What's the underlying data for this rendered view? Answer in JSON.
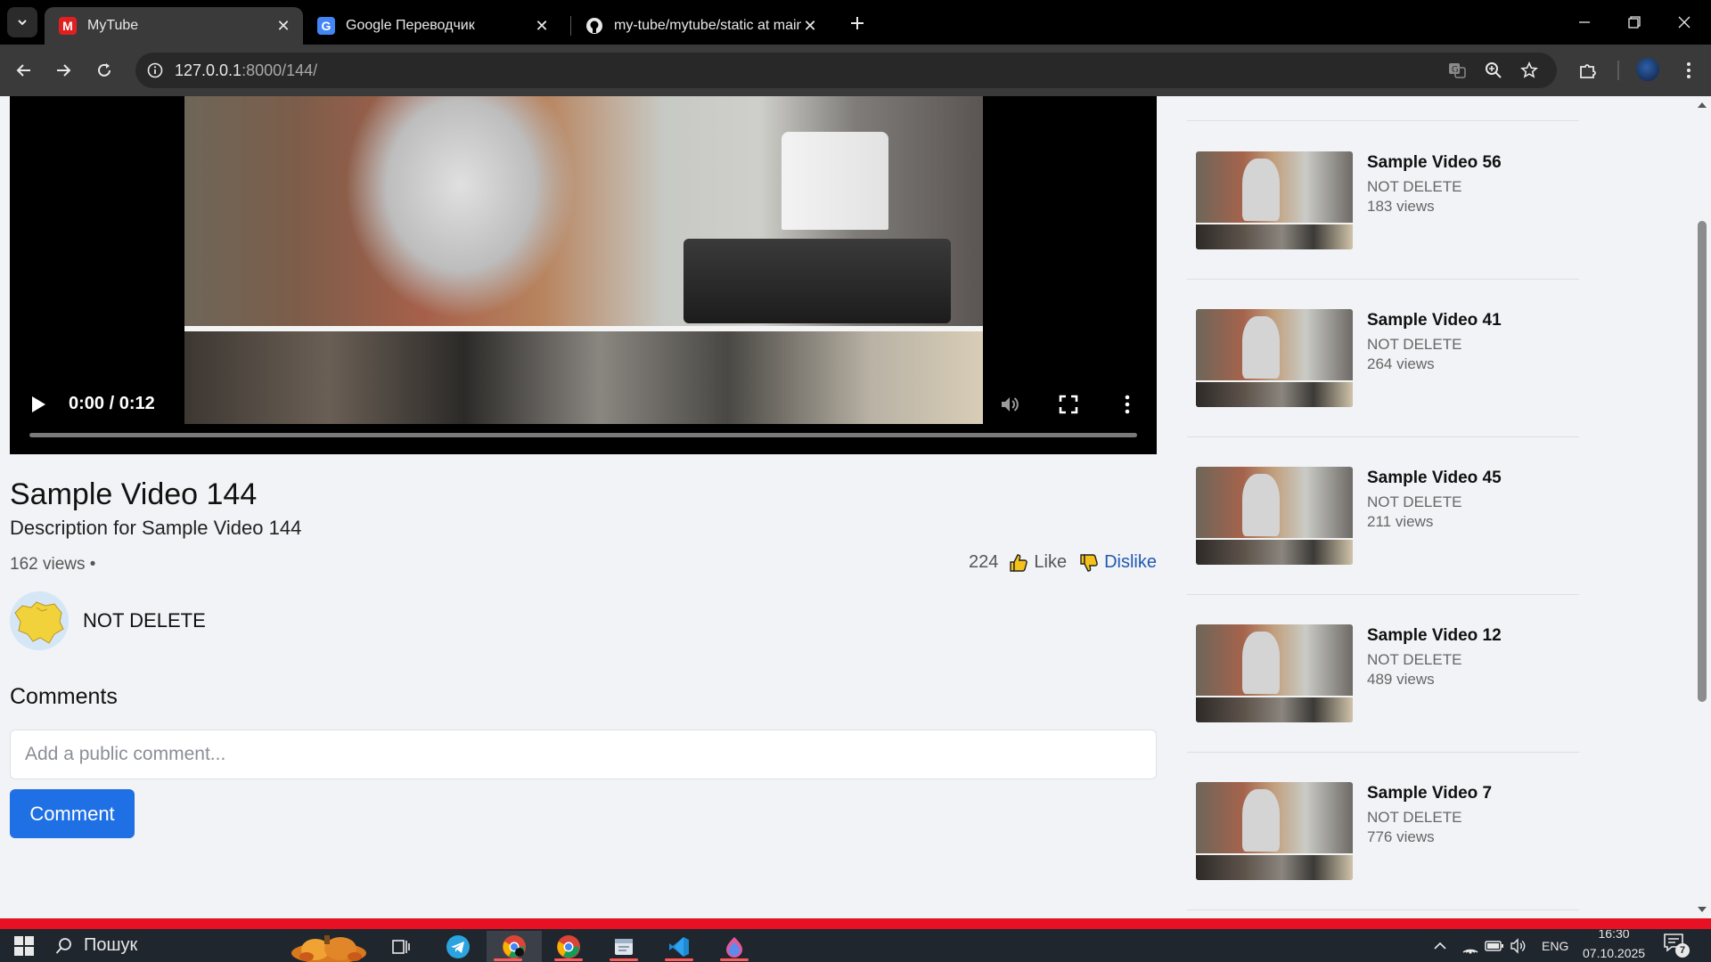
{
  "browser": {
    "tabs": [
      {
        "title": "MyTube",
        "favicon": "M",
        "active": true
      },
      {
        "title": "Google Переводчик",
        "favicon": "G",
        "active": false
      },
      {
        "title": "my-tube/mytube/static at main",
        "favicon": "github-icon",
        "active": false
      }
    ],
    "address": {
      "host": "127.0.0.1",
      "path": ":8000/144/"
    }
  },
  "video": {
    "time": "0:00 / 0:12",
    "progress_fraction": 0,
    "title": "Sample Video 144",
    "description": "Description for Sample Video 144",
    "views": "162 views •",
    "likes_count": "224",
    "like_label": "Like",
    "dislike_label": "Dislike",
    "channel_name": "NOT DELETE"
  },
  "comments": {
    "heading": "Comments",
    "placeholder": "Add a public comment...",
    "button_label": "Comment"
  },
  "recommendations": [
    {
      "title": "Sample Video 56",
      "channel": "NOT DELETE",
      "views": "183 views"
    },
    {
      "title": "Sample Video 41",
      "channel": "NOT DELETE",
      "views": "264 views"
    },
    {
      "title": "Sample Video 45",
      "channel": "NOT DELETE",
      "views": "211 views"
    },
    {
      "title": "Sample Video 12",
      "channel": "NOT DELETE",
      "views": "489 views"
    },
    {
      "title": "Sample Video 7",
      "channel": "NOT DELETE",
      "views": "776 views"
    }
  ],
  "taskbar": {
    "search_label": "Пошук",
    "language": "ENG",
    "time": "16:30",
    "date": "07.10.2025",
    "notifications": "7"
  },
  "colors": {
    "accent": "#1f6fe5",
    "dislike": "#1f59b3",
    "page_background": "#f1f3f6",
    "alert_strip": "#e81123"
  }
}
